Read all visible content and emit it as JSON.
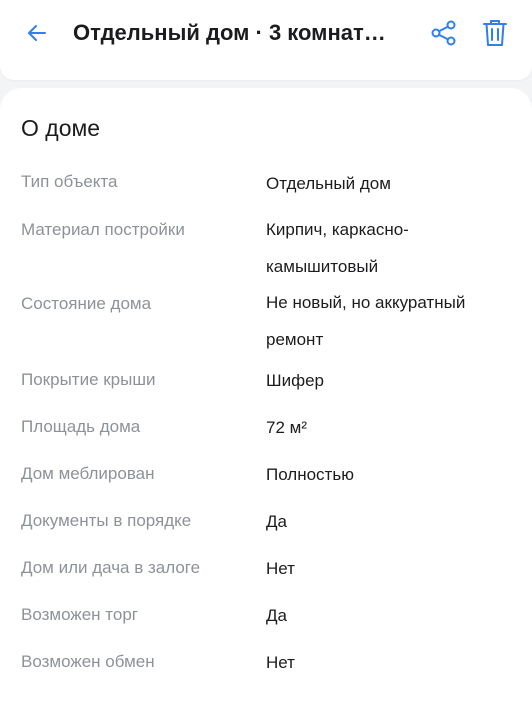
{
  "header": {
    "title": "Отдельный дом · 3 комнаты...",
    "back_icon": "arrow-left-icon",
    "share_icon": "share-icon",
    "delete_icon": "trash-icon",
    "accent_color": "#2f80ed"
  },
  "section": {
    "title": "О доме"
  },
  "details": [
    {
      "label": "Тип объекта",
      "value": "Отдельный дом"
    },
    {
      "label": "Материал постройки",
      "value": "Кирпич, каркасно-камышитовый"
    },
    {
      "label": "Состояние дома",
      "value": "Не новый, но аккуратный ремонт"
    },
    {
      "label": "Покрытие крыши",
      "value": "Шифер"
    },
    {
      "label": "Площадь дома",
      "value": "72 м²"
    },
    {
      "label": "Дом меблирован",
      "value": "Полностью"
    },
    {
      "label": "Документы в порядке",
      "value": "Да"
    },
    {
      "label": "Дом или дача в залоге",
      "value": "Нет"
    },
    {
      "label": "Возможен торг",
      "value": "Да"
    },
    {
      "label": "Возможен обмен",
      "value": "Нет"
    }
  ]
}
